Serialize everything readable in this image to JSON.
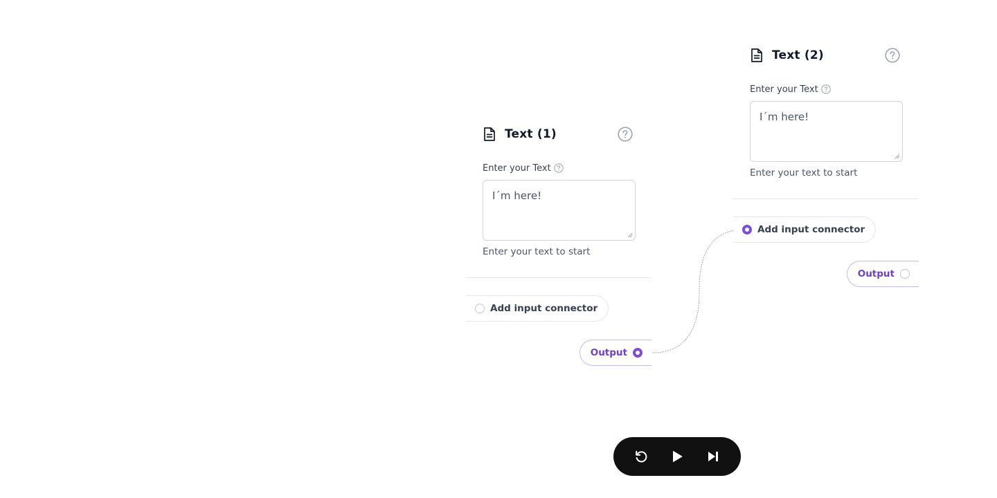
{
  "nodes": [
    {
      "title": "Text (1)",
      "field_label": "Enter your Text",
      "text_value": "I´m here!",
      "hint": "Enter your text to start",
      "input_connector_label": "Add input connector",
      "input_connector_connected": false,
      "output_label": "Output",
      "output_connected": true
    },
    {
      "title": "Text (2)",
      "field_label": "Enter your Text",
      "text_value": "I´m here!",
      "hint": "Enter your text to start",
      "input_connector_label": "Add input connector",
      "input_connector_connected": true,
      "output_label": "Output",
      "output_connected": false
    }
  ],
  "controls": {
    "icons": [
      "reset-icon",
      "play-icon",
      "skip-forward-icon"
    ]
  },
  "colors": {
    "accent": "#7c4ddb",
    "output_text": "#6d3fd1",
    "control_bar": "#111111"
  }
}
